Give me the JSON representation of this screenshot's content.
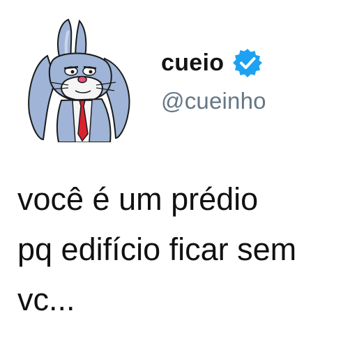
{
  "user": {
    "display_name": "cueio",
    "handle": "@cueinho",
    "avatar": "bugs-bunny-avatar",
    "verified_icon": "verified-badge-icon"
  },
  "tweet": {
    "text": "você é um prédio\npq edifício ficar sem\nvc..."
  },
  "colors": {
    "verified_badge": "#1da1f2",
    "handle": "#657786",
    "text": "#111111",
    "avatar_fur": "#9fb4d6",
    "avatar_tie": "#d9232e"
  }
}
